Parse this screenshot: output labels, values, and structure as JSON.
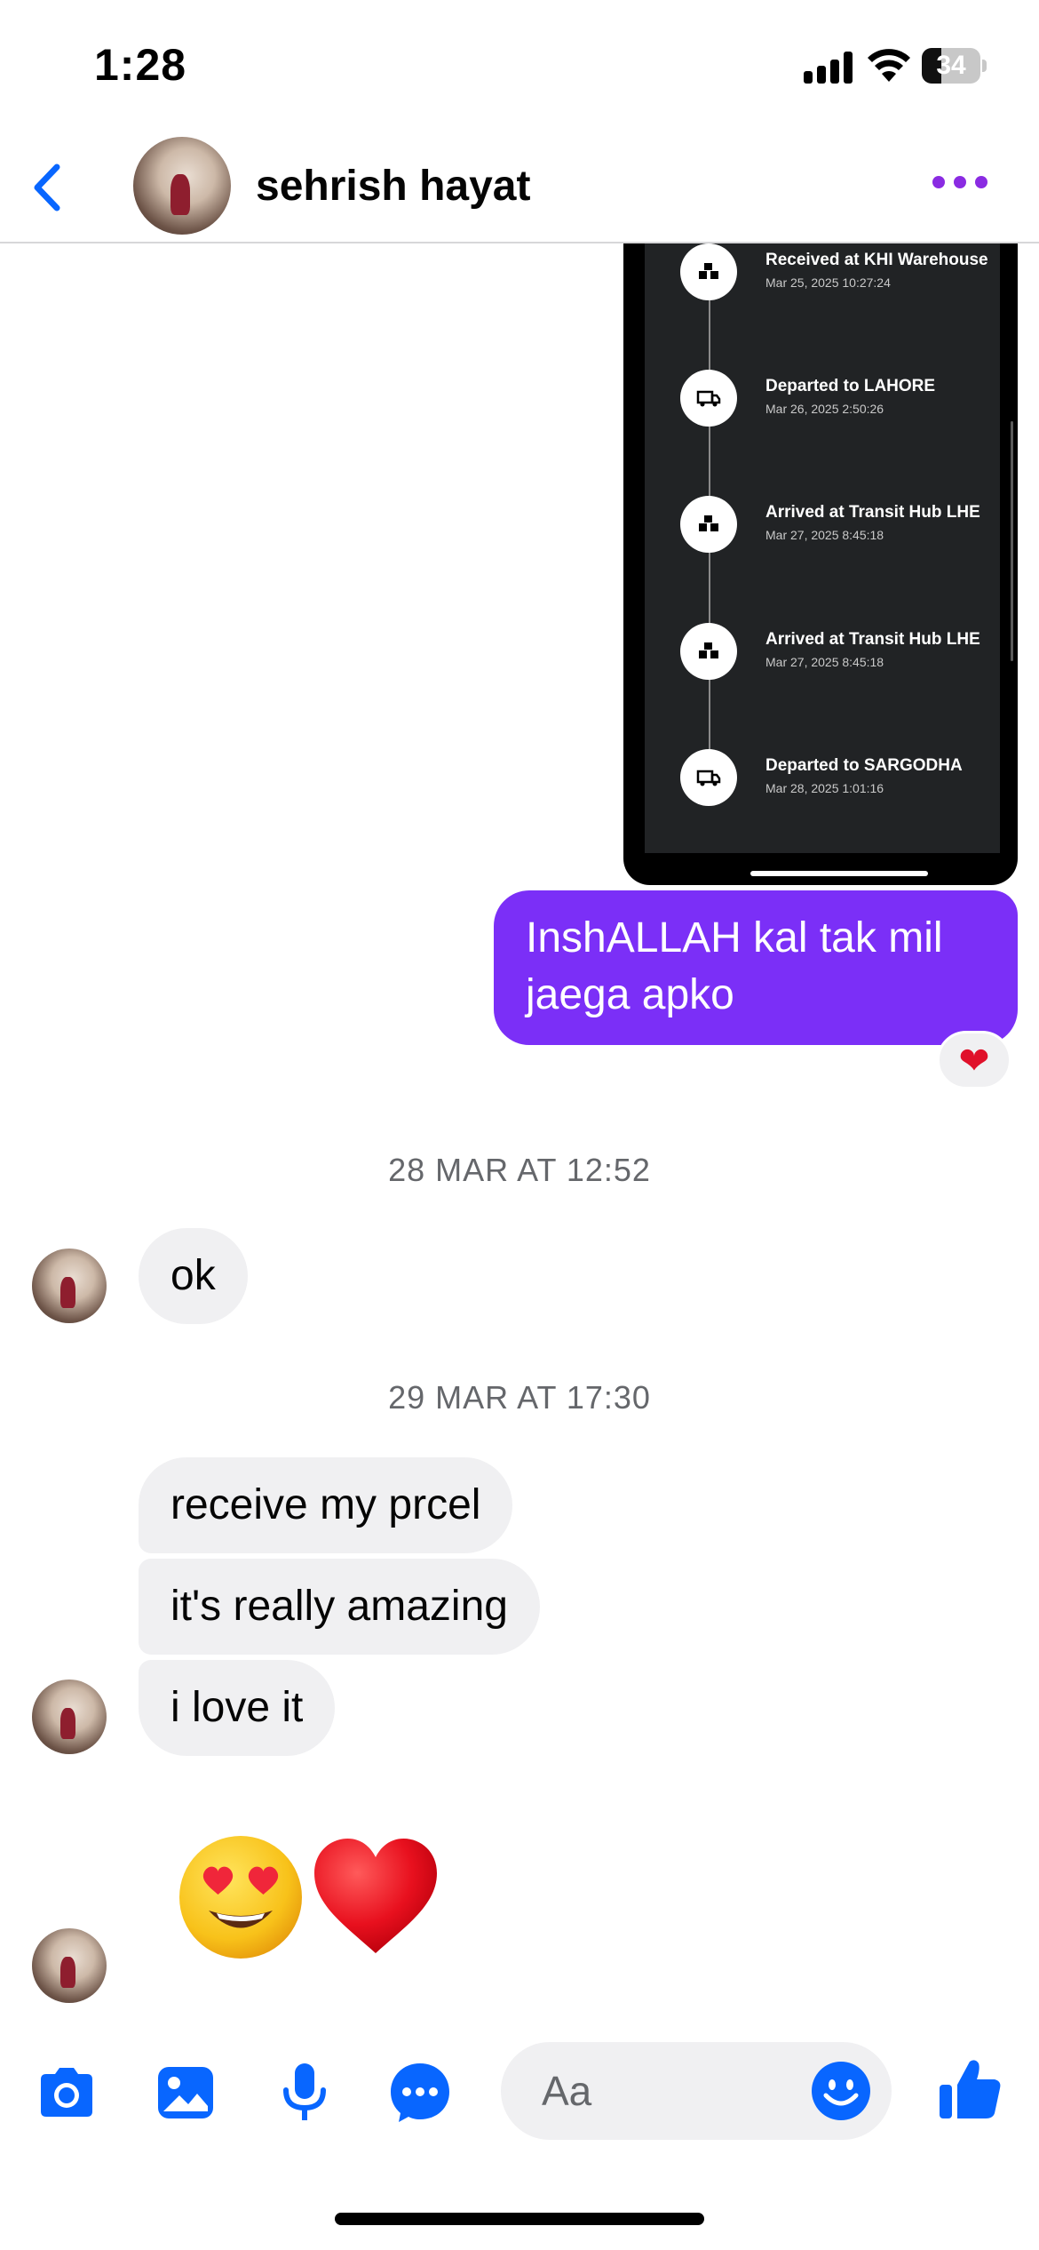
{
  "status_bar": {
    "time": "1:28",
    "battery": "34",
    "battery_level": 0.34
  },
  "header": {
    "contact_name": "sehrish hayat"
  },
  "shared_image": {
    "events": [
      {
        "title": "Received at KHI Warehouse",
        "time": "Mar 25, 2025 10:27:24",
        "icon": "warehouse-icon"
      },
      {
        "title": "Departed to LAHORE",
        "time": "Mar 26, 2025 2:50:26",
        "icon": "truck-icon"
      },
      {
        "title": "Arrived at Transit Hub LHE",
        "time": "Mar 27, 2025 8:45:18",
        "icon": "warehouse-icon"
      },
      {
        "title": "Arrived at Transit Hub LHE",
        "time": "Mar 27, 2025 8:45:18",
        "icon": "warehouse-icon"
      },
      {
        "title": "Departed to SARGODHA",
        "time": "Mar 28, 2025 1:01:16",
        "icon": "truck-icon"
      }
    ]
  },
  "messages": {
    "outgoing_1": "InshALLAH kal tak mil jaega apko",
    "outgoing_1_reaction": "❤",
    "timestamp_1": "28 MAR AT 12:52",
    "incoming_1": "ok",
    "timestamp_2": "29 MAR AT 17:30",
    "incoming_2": "receive my prcel",
    "incoming_3": "it's really amazing",
    "incoming_4": "i love it",
    "incoming_5_emoji": [
      "heart-eyes-emoji",
      "red-heart-emoji"
    ]
  },
  "composer": {
    "placeholder": "Aa"
  },
  "colors": {
    "accent": "#0866ff",
    "outgoing_bubble": "#7b2ff7",
    "incoming_bubble": "#f0f0f2",
    "more_dots": "#8a2be2"
  }
}
